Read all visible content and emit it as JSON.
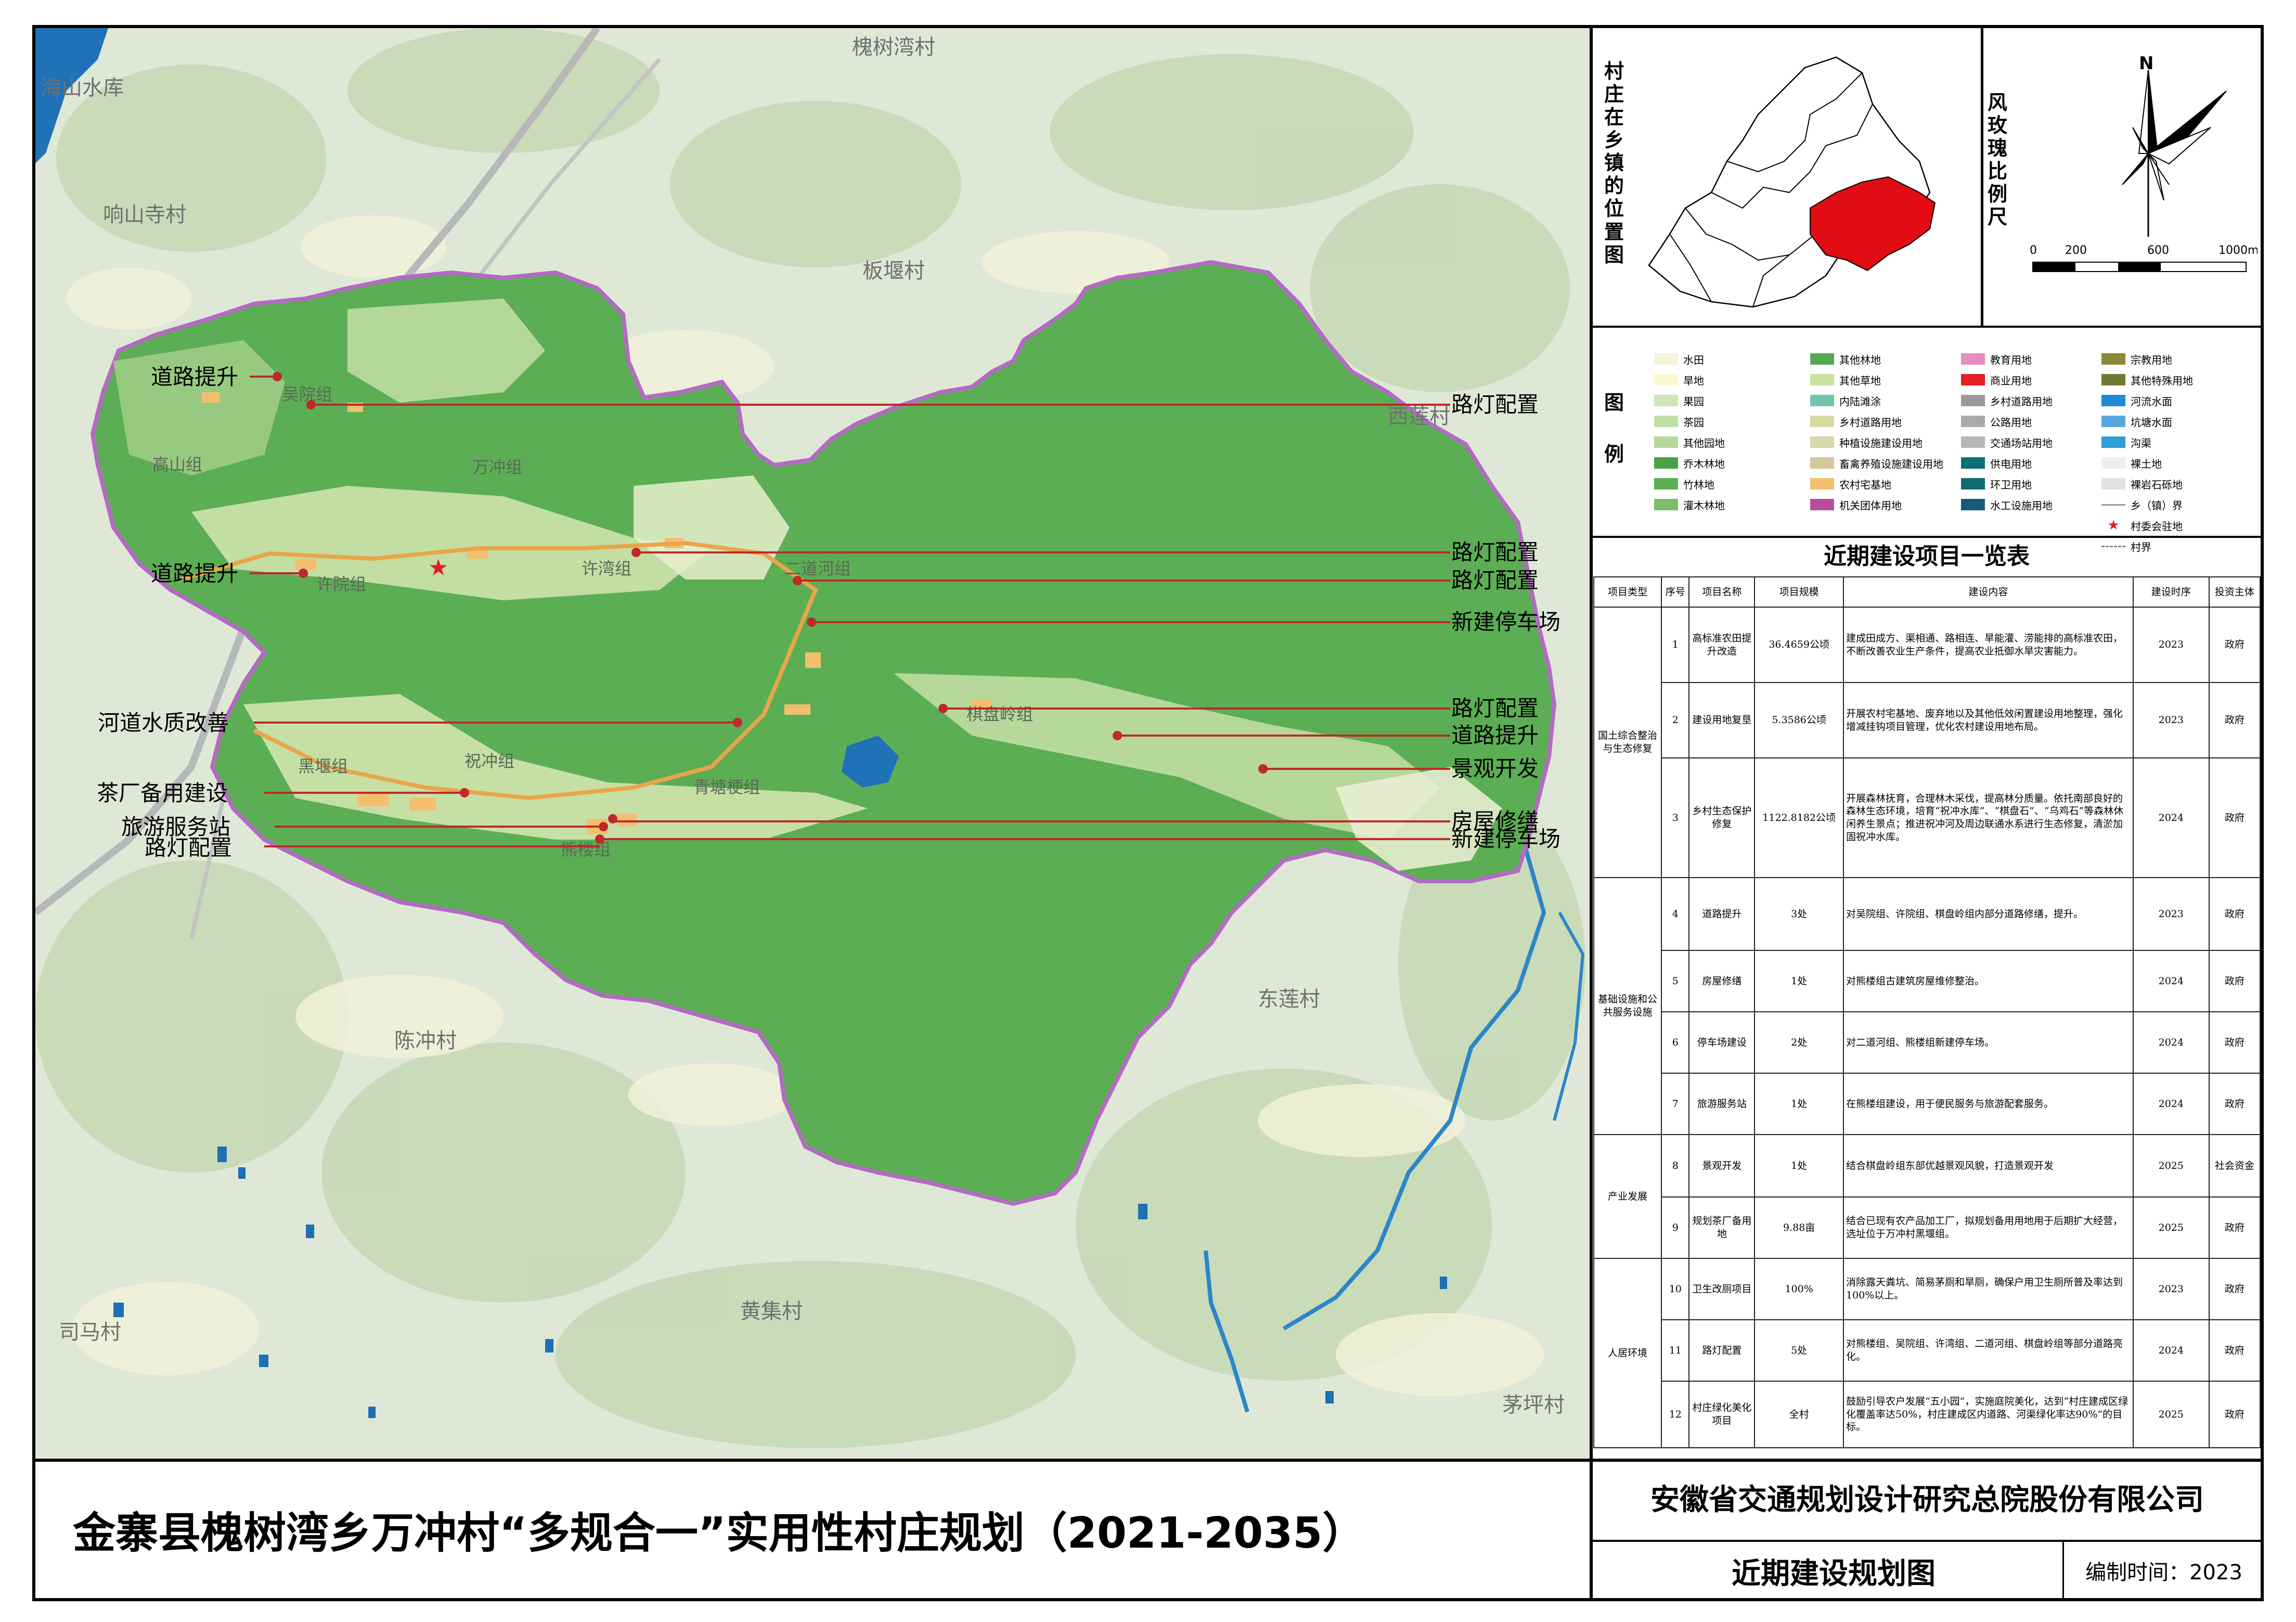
{
  "main_title": "金寨县槐树湾乡万冲村“多规合一”实用性村庄规划（2021-2035）",
  "company": "安徽省交通规划设计研究总院股份有限公司",
  "drawing_name": "近期建设规划图",
  "compile_date": "编制时间：2023",
  "location_map_title": "村庄在乡镇的位置图",
  "scale_title": "风玫瑰比例尺",
  "north_label": "N",
  "scale_labels": [
    "0",
    "200",
    "600",
    "1000m"
  ],
  "legend_title": "图例",
  "legend": [
    {
      "label": "水田",
      "color": "#f4f5d8"
    },
    {
      "label": "旱地",
      "color": "#fbf9cf"
    },
    {
      "label": "果园",
      "color": "#cfe6b6"
    },
    {
      "label": "茶园",
      "color": "#bfdea2"
    },
    {
      "label": "其他园地",
      "color": "#b6d99a"
    },
    {
      "label": "乔木林地",
      "color": "#49a247"
    },
    {
      "label": "竹林地",
      "color": "#5cae54"
    },
    {
      "label": "灌木林地",
      "color": "#7dbd6a"
    },
    {
      "label": "其他林地",
      "color": "#56a850"
    },
    {
      "label": "其他草地",
      "color": "#c9e3a2"
    },
    {
      "label": "内陆滩涂",
      "color": "#70c4b0"
    },
    {
      "label": "乡村道路用地",
      "color": "#d7dba0"
    },
    {
      "label": "种植设施建设用地",
      "color": "#d9d8a8"
    },
    {
      "label": "畜禽养殖设施建设用地",
      "color": "#d2c89a"
    },
    {
      "label": "农村宅基地",
      "color": "#f3bf6f"
    },
    {
      "label": "机关团体用地",
      "color": "#b54f9d"
    },
    {
      "label": "教育用地",
      "color": "#e48fbf"
    },
    {
      "label": "商业用地",
      "color": "#e31e24"
    },
    {
      "label": "乡村道路用地",
      "color": "#9a9a9a"
    },
    {
      "label": "公路用地",
      "color": "#aaaaaa"
    },
    {
      "label": "交通场站用地",
      "color": "#b7b7b7"
    },
    {
      "label": "供电用地",
      "color": "#0d6e78"
    },
    {
      "label": "环卫用地",
      "color": "#0f6b6f"
    },
    {
      "label": "水工设施用地",
      "color": "#155b78"
    },
    {
      "label": "宗教用地",
      "color": "#8b8a3a"
    },
    {
      "label": "其他特殊用地",
      "color": "#6f7a2e"
    },
    {
      "label": "河流水面",
      "color": "#1f8ad6"
    },
    {
      "label": "坑塘水面",
      "color": "#58a8e0"
    },
    {
      "label": "沟渠",
      "color": "#2b9ed3"
    },
    {
      "label": "裸土地",
      "color": "#eeeeee"
    },
    {
      "label": "裸岩石砾地",
      "color": "#e2e2e2"
    },
    {
      "label": "乡（镇）界",
      "color": "#999999"
    },
    {
      "label": "村委会驻地",
      "color": "#e31e24"
    },
    {
      "label": "村界",
      "color": "#888888"
    }
  ],
  "map_labels": {
    "villages": [
      "海山水库",
      "槐树湾村",
      "响山寺村",
      "板堰村",
      "西莲村",
      "东莲村",
      "陈冲村",
      "黄集村",
      "司马村",
      "茅坪村"
    ],
    "groups": [
      "吴院组",
      "高山组",
      "万冲组",
      "许院组",
      "许湾组",
      "二道河组",
      "棋盘岭组",
      "黑堰组",
      "祝冲组",
      "青塘梗组",
      "熊楼组"
    ]
  },
  "annotations": {
    "left": [
      "道路提升",
      "道路提升",
      "河道水质改善",
      "茶厂备用建设",
      "旅游服务站",
      "路灯配置"
    ],
    "right": [
      "路灯配置",
      "路灯配置",
      "路灯配置",
      "新建停车场",
      "路灯配置",
      "道路提升",
      "景观开发",
      "房屋修缮",
      "新建停车场"
    ]
  },
  "table": {
    "title": "近期建设项目一览表",
    "headers": [
      "项目类型",
      "序号",
      "项目名称",
      "项目规模",
      "建设内容",
      "建设时序",
      "投资主体"
    ],
    "categories": [
      "国土综合整治与生态修复",
      "基础设施和公共服务设施",
      "产业发展",
      "人居环境"
    ],
    "rows": [
      {
        "no": "1",
        "name": "高标准农田提升改造",
        "scale": "36.4659公顷",
        "content": "建成田成方、渠相通、路相连、旱能灌、涝能排的高标准农田，不断改善农业生产条件，提高农业抵御水旱灾害能力。",
        "year": "2023",
        "investor": "政府"
      },
      {
        "no": "2",
        "name": "建设用地复垦",
        "scale": "5.3586公顷",
        "content": "开展农村宅基地、废弃地以及其他低效闲置建设用地整理，强化增减挂钩项目管理，优化农村建设用地布局。",
        "year": "2023",
        "investor": "政府"
      },
      {
        "no": "3",
        "name": "乡村生态保护修复",
        "scale": "1122.8182公顷",
        "content": "开展森林抚育，合理林木采伐，提高林分质量。依托南部良好的森林生态环境，培育“祝冲水库”、“棋盘石”、“乌鸡石”等森林休闲养生景点；推进祝冲河及周边联通水系进行生态修复，清淤加固祝冲水库。",
        "year": "2024",
        "investor": "政府"
      },
      {
        "no": "4",
        "name": "道路提升",
        "scale": "3处",
        "content": "对吴院组、许院组、棋盘岭组内部分道路修缮，提升。",
        "year": "2023",
        "investor": "政府"
      },
      {
        "no": "5",
        "name": "房屋修缮",
        "scale": "1处",
        "content": "对熊楼组古建筑房屋维修整治。",
        "year": "2024",
        "investor": "政府"
      },
      {
        "no": "6",
        "name": "停车场建设",
        "scale": "2处",
        "content": "对二道河组、熊楼组新建停车场。",
        "year": "2024",
        "investor": "政府"
      },
      {
        "no": "7",
        "name": "旅游服务站",
        "scale": "1处",
        "content": "在熊楼组建设，用于便民服务与旅游配套服务。",
        "year": "2024",
        "investor": "政府"
      },
      {
        "no": "8",
        "name": "景观开发",
        "scale": "1处",
        "content": "结合棋盘岭组东部优越景观风貌，打造景观开发",
        "year": "2025",
        "investor": "社会资金"
      },
      {
        "no": "9",
        "name": "规划茶厂备用地",
        "scale": "9.88亩",
        "content": "结合已现有农产品加工厂，拟规划备用用地用于后期扩大经营，选址位于万冲村黑堰组。",
        "year": "2025",
        "investor": "政府"
      },
      {
        "no": "10",
        "name": "卫生改厕项目",
        "scale": "100%",
        "content": "消除露天粪坑、简易茅厕和旱厕，确保户用卫生厕所普及率达到100%以上。",
        "year": "2023",
        "investor": "政府"
      },
      {
        "no": "11",
        "name": "路灯配置",
        "scale": "5处",
        "content": "对熊楼组、吴院组、许湾组、二道河组、棋盘岭组等部分道路亮化。",
        "year": "2024",
        "investor": "政府"
      },
      {
        "no": "12",
        "name": "村庄绿化美化项目",
        "scale": "全村",
        "content": "鼓励引导农户发展“五小园”，实施庭院美化，达到“村庄建成区绿化覆盖率达50%，村庄建成区内道路、河渠绿化率达90%”的目标。",
        "year": "2025",
        "investor": "政府"
      }
    ]
  }
}
